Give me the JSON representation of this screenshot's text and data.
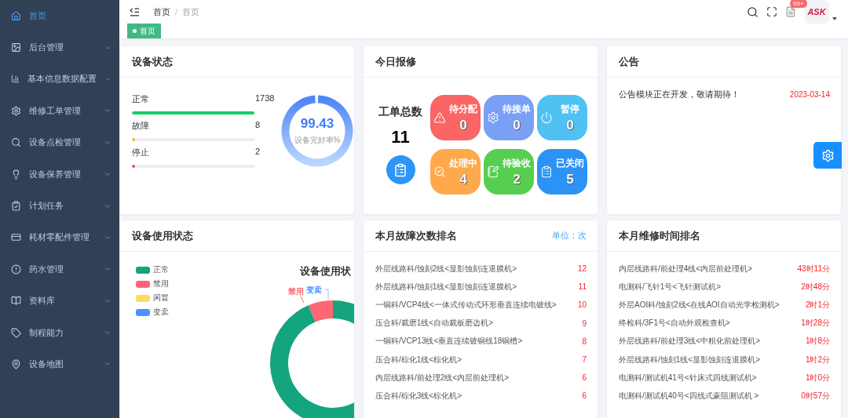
{
  "sidebar": {
    "items": [
      {
        "label": "首页",
        "selected": true,
        "has_submenu": false
      },
      {
        "label": "后台管理",
        "selected": false,
        "has_submenu": true
      },
      {
        "label": "基本信息数据配置",
        "selected": false,
        "has_submenu": true
      },
      {
        "label": "维修工单管理",
        "selected": false,
        "has_submenu": true
      },
      {
        "label": "设备点检管理",
        "selected": false,
        "has_submenu": true
      },
      {
        "label": "设备保养管理",
        "selected": false,
        "has_submenu": true
      },
      {
        "label": "计划任务",
        "selected": false,
        "has_submenu": true
      },
      {
        "label": "耗材零配件管理",
        "selected": false,
        "has_submenu": true
      },
      {
        "label": "药水管理",
        "selected": false,
        "has_submenu": true
      },
      {
        "label": "资料库",
        "selected": false,
        "has_submenu": true
      },
      {
        "label": "制程能力",
        "selected": false,
        "has_submenu": true
      },
      {
        "label": "设备地图",
        "selected": false,
        "has_submenu": true
      }
    ]
  },
  "header": {
    "breadcrumb": [
      "首页",
      "首页"
    ],
    "separator": "/",
    "notification_badge": "99+",
    "avatar_logo": "ASK"
  },
  "tags": [
    {
      "label": "首页",
      "selected": true
    }
  ],
  "device_status": {
    "title": "设备状态",
    "rows": [
      {
        "label": "正常",
        "value": "1738",
        "level": 0.994,
        "color": "#13ce66"
      },
      {
        "label": "故障",
        "value": "8",
        "level": 0.005,
        "color": "#ffba00"
      },
      {
        "label": "停止",
        "value": "2",
        "level": 0.002,
        "color": "#ff4949"
      }
    ],
    "gauge": {
      "value": "99.43",
      "caption": "设备完好率%",
      "level": 0.9943
    }
  },
  "repairs": {
    "title": "今日报修",
    "total_label": "工单总数",
    "total": "11",
    "tiles": [
      {
        "label": "待分配",
        "count": "0",
        "color": "#fa6565"
      },
      {
        "label": "待接单",
        "count": "0",
        "color": "#79a0f5"
      },
      {
        "label": "暂停",
        "count": "0",
        "color": "#4fc1f3"
      },
      {
        "label": "处理中",
        "count": "4",
        "color": "#ffa94c"
      },
      {
        "label": "待验收",
        "count": "2",
        "color": "#56cf50"
      },
      {
        "label": "已关闭",
        "count": "5",
        "color": "#2b93f6"
      }
    ]
  },
  "notice": {
    "title": "公告",
    "items": [
      {
        "text": "公告模块正在开发，敬请期待！",
        "date": "2023-03-14"
      }
    ]
  },
  "usage": {
    "title": "设备使用状态",
    "chart_title": "设备使用状",
    "legend": [
      {
        "label": "正常",
        "color": "#14a57f"
      },
      {
        "label": "禁用",
        "color": "#fd6673"
      },
      {
        "label": "闲置",
        "color": "#fddd60"
      },
      {
        "label": "变卖",
        "color": "#4992ff"
      }
    ],
    "slice_labels": [
      {
        "text": "禁用",
        "color": "#fd6673"
      },
      {
        "text": "变卖",
        "color": "#4992ff"
      }
    ]
  },
  "fault_ranking": {
    "title": "本月故障次数排名",
    "unit": "单位：次",
    "rows": [
      {
        "name": "外层线路科/蚀刻2线<显影蚀刻连退膜机>",
        "value": "12"
      },
      {
        "name": "外层线路科/蚀刻1线<显影蚀刻连退膜机>",
        "value": "11"
      },
      {
        "name": "一铜科/VCP4线<一体式传动式环形垂直连续电镀线>",
        "value": "10"
      },
      {
        "name": "压合科/裁磨1线<自动裁板磨边机>",
        "value": "9"
      },
      {
        "name": "一铜科/VCP13线<垂直连续镀铜线18铜槽>",
        "value": "8"
      },
      {
        "name": "压合科/棕化1线<棕化机>",
        "value": "7"
      },
      {
        "name": "内层线路科/前处理2线<内层前处理机>",
        "value": "6"
      },
      {
        "name": "压合科/棕化3线<棕化机>",
        "value": "6"
      }
    ]
  },
  "repair_time_ranking": {
    "title": "本月维修时间排名",
    "rows": [
      {
        "name": "内层线路科/前处理4线<内层前处理机>",
        "value": "43时11分"
      },
      {
        "name": "电测科/飞针1号<飞针测试机>",
        "value": "2时48分"
      },
      {
        "name": "外层AOI科/蚀刻2线<在线AOI自动光学检测机>",
        "value": "2时1分"
      },
      {
        "name": "终检科/3F1号<自动外观检查机>",
        "value": "1时28分"
      },
      {
        "name": "外层线路科/前处理3线<中粗化前处理机>",
        "value": "1时8分"
      },
      {
        "name": "外层线路科/蚀刻1线<显影蚀刻连退膜机>",
        "value": "1时2分"
      },
      {
        "name": "电测科/测试机41号<针床式四线测试机>",
        "value": "1时0分"
      },
      {
        "name": "电测科/测试机40号<四线式豪阻测试机 >",
        "value": "0时57分"
      }
    ]
  }
}
